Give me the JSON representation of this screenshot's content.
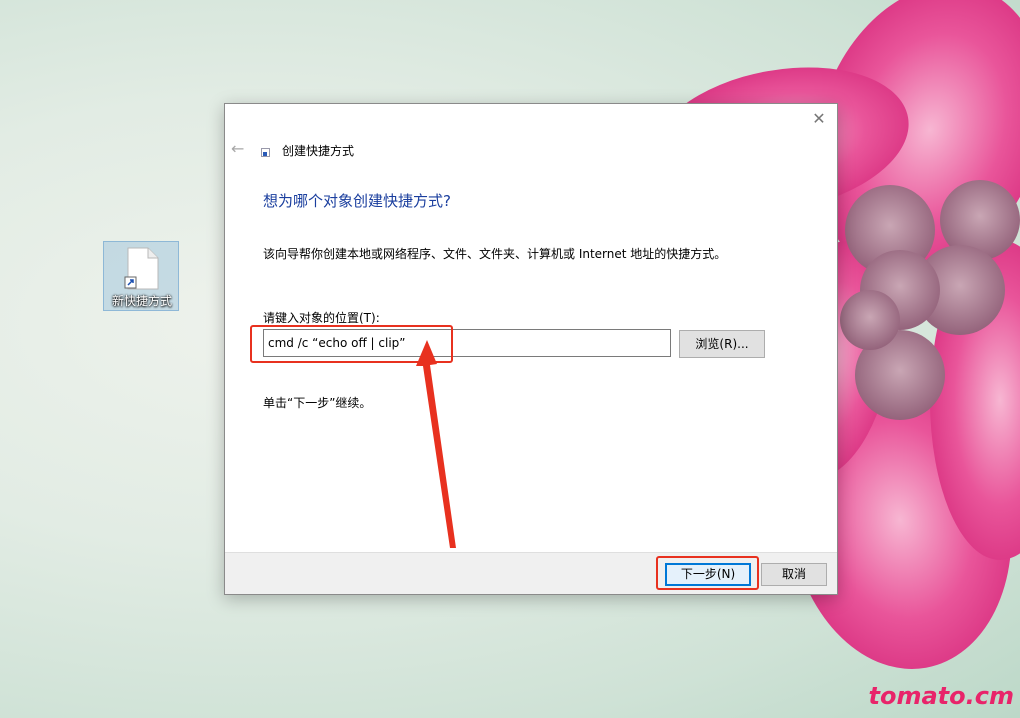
{
  "desktop": {
    "icon_label": "新快捷方式"
  },
  "dialog": {
    "title": "创建快捷方式",
    "heading": "想为哪个对象创建快捷方式?",
    "description": "该向导帮你创建本地或网络程序、文件、文件夹、计算机或 Internet 地址的快捷方式。",
    "field_label": "请键入对象的位置(T):",
    "location_value": "cmd /c “echo off | clip”",
    "browse_label": "浏览(R)...",
    "hint": "单击“下一步”继续。",
    "next_label": "下一步(N)",
    "cancel_label": "取消"
  },
  "watermark": "tomato.cm",
  "colors": {
    "heading": "#1a3e9e",
    "annotation": "#e8311f",
    "watermark": "#e8246a",
    "flower": "#e23b86"
  },
  "icons": [
    "back-arrow-icon",
    "shortcut-icon",
    "close-icon",
    "file-shortcut-icon"
  ]
}
